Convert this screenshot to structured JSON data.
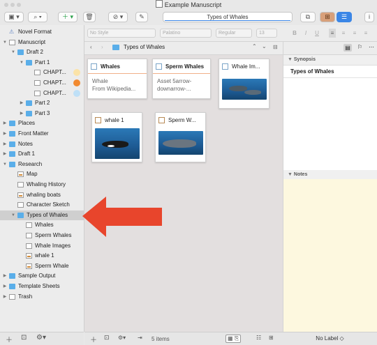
{
  "window": {
    "title": "Example Manuscript"
  },
  "toolbar": {
    "search_text": "Types of Whales"
  },
  "binder": {
    "items": [
      {
        "label": "Novel Format",
        "indent": 0,
        "kind": "warn",
        "tri": ""
      },
      {
        "label": "Manuscript",
        "indent": 0,
        "kind": "doc",
        "tri": "▼"
      },
      {
        "label": "Draft 2",
        "indent": 1,
        "kind": "folder",
        "tri": "▼"
      },
      {
        "label": "Part 1",
        "indent": 2,
        "kind": "folder",
        "tri": "▼"
      },
      {
        "label": "CHAPT...",
        "indent": 3,
        "kind": "doc",
        "tri": "",
        "dot": "#fbe3a8"
      },
      {
        "label": "CHAPT...",
        "indent": 3,
        "kind": "doc",
        "tri": "",
        "dot": "#f28a30"
      },
      {
        "label": "CHAPT...",
        "indent": 3,
        "kind": "doc",
        "tri": "",
        "dot": "#bfe0f7"
      },
      {
        "label": "Part 2",
        "indent": 2,
        "kind": "folder",
        "tri": "▶"
      },
      {
        "label": "Part 3",
        "indent": 2,
        "kind": "folder",
        "tri": "▶"
      },
      {
        "label": "Places",
        "indent": 0,
        "kind": "folder",
        "tri": "▶"
      },
      {
        "label": "Front Matter",
        "indent": 0,
        "kind": "folder",
        "tri": "▶"
      },
      {
        "label": "Notes",
        "indent": 0,
        "kind": "folder",
        "tri": "▶"
      },
      {
        "label": "Draft 1",
        "indent": 0,
        "kind": "folder",
        "tri": "▶"
      },
      {
        "label": "Research",
        "indent": 0,
        "kind": "folder",
        "tri": "▼"
      },
      {
        "label": "Map",
        "indent": 1,
        "kind": "img",
        "tri": ""
      },
      {
        "label": "Whaling History",
        "indent": 1,
        "kind": "doc",
        "tri": ""
      },
      {
        "label": "whaling boats",
        "indent": 1,
        "kind": "img",
        "tri": ""
      },
      {
        "label": "Character Sketch",
        "indent": 1,
        "kind": "doc",
        "tri": ""
      },
      {
        "label": "Types of Whales",
        "indent": 1,
        "kind": "folder",
        "tri": "▼",
        "selected": true
      },
      {
        "label": "Whales",
        "indent": 2,
        "kind": "doc",
        "tri": ""
      },
      {
        "label": "Sperm Whales",
        "indent": 2,
        "kind": "doc",
        "tri": ""
      },
      {
        "label": "Whale Images",
        "indent": 2,
        "kind": "doc",
        "tri": ""
      },
      {
        "label": "whale 1",
        "indent": 2,
        "kind": "img",
        "tri": ""
      },
      {
        "label": "Sperm Whale",
        "indent": 2,
        "kind": "img",
        "tri": ""
      },
      {
        "label": "Sample Output",
        "indent": 0,
        "kind": "folder",
        "tri": "▶"
      },
      {
        "label": "Template Sheets",
        "indent": 0,
        "kind": "folder",
        "tri": "▶"
      },
      {
        "label": "Trash",
        "indent": 0,
        "kind": "doc",
        "tri": "▶"
      }
    ]
  },
  "format": {
    "style": "No Style",
    "font": "Palatino",
    "weight": "Regular",
    "size": "13"
  },
  "path": {
    "title": "Types of Whales"
  },
  "cards": [
    {
      "title": "Whales",
      "synopsis_line1": "Whale",
      "synopsis_line2": "From Wikipedia...",
      "thumb": ""
    },
    {
      "title": "Sperm Whales",
      "synopsis_line1": "Asset 5arrow-",
      "synopsis_line2": "downarrow-...",
      "thumb": ""
    },
    {
      "title": "Whale Im...",
      "synopsis_line1": "",
      "synopsis_line2": "",
      "thumb": "whales"
    },
    {
      "title": "whale 1",
      "synopsis_line1": "",
      "synopsis_line2": "",
      "thumb": "orca"
    },
    {
      "title": "Sperm W...",
      "synopsis_line1": "",
      "synopsis_line2": "",
      "thumb": "sperm"
    }
  ],
  "corkboard_footer": {
    "count_text": "5 items"
  },
  "inspector": {
    "synopsis_header": "Synopsis",
    "synopsis_title": "Types of Whales",
    "notes_header": "Notes",
    "label_value": "No Label"
  },
  "colors": {
    "accent": "#3b86e6",
    "arrow": "#e8452c",
    "selection": "#cfcfcf",
    "notes_bg": "#fdf8df"
  }
}
